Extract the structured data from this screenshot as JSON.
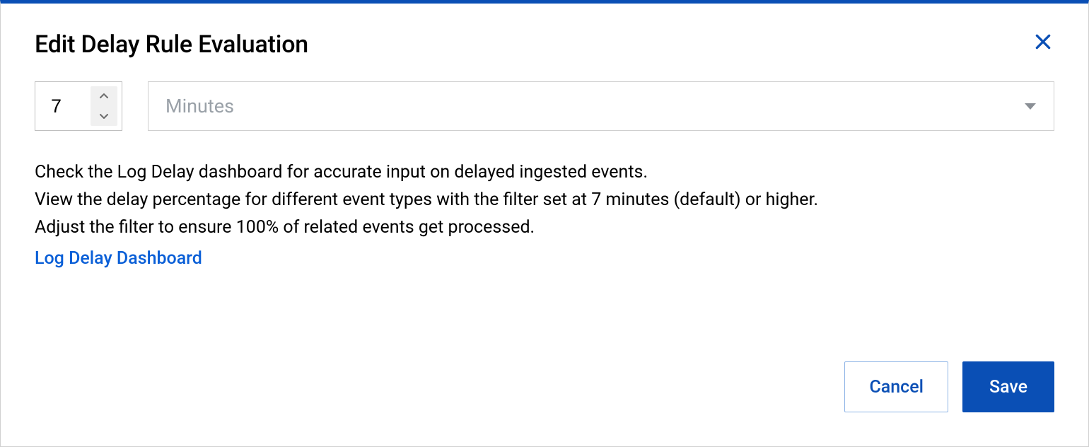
{
  "title": "Edit Delay Rule Evaluation",
  "delay": {
    "value": "7",
    "unit_selected": "Minutes"
  },
  "description": {
    "line1": "Check the Log Delay dashboard for accurate input on delayed ingested events.",
    "line2": "View the delay percentage for different event types with the filter set at 7 minutes (default) or higher.",
    "line3": "Adjust the filter to ensure 100% of related events get processed."
  },
  "link_label": "Log Delay Dashboard",
  "buttons": {
    "cancel": "Cancel",
    "save": "Save"
  }
}
